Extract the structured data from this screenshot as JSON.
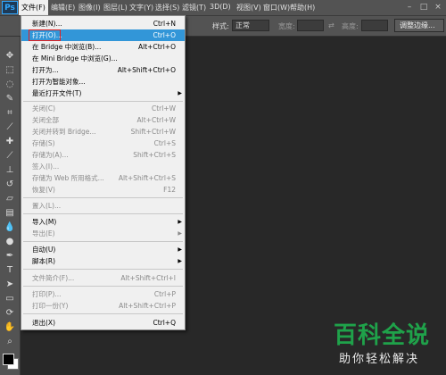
{
  "app": {
    "logo": "Ps"
  },
  "menubar": {
    "items": [
      "文件(F)",
      "编辑(E)",
      "图像(I)",
      "图层(L)",
      "文字(Y)",
      "选择(S)",
      "滤镜(T)",
      "3D(D)",
      "视图(V)",
      "窗口(W)",
      "帮助(H)"
    ]
  },
  "options": {
    "style_label": "样式:",
    "style_value": "正常",
    "width_label": "宽度:",
    "height_label": "高度:",
    "edge_button": "调整边缘..."
  },
  "file_menu": {
    "items": [
      {
        "label": "新建(N)...",
        "shortcut": "Ctrl+N",
        "disabled": false
      },
      {
        "label": "打开(O)...",
        "shortcut": "Ctrl+O",
        "disabled": false,
        "highlighted": true
      },
      {
        "label": "在 Bridge 中浏览(B)...",
        "shortcut": "Alt+Ctrl+O",
        "disabled": false
      },
      {
        "label": "在 Mini Bridge 中浏览(G)...",
        "shortcut": "",
        "disabled": false
      },
      {
        "label": "打开为...",
        "shortcut": "Alt+Shift+Ctrl+O",
        "disabled": false
      },
      {
        "label": "打开为智能对象...",
        "shortcut": "",
        "disabled": false
      },
      {
        "label": "最近打开文件(T)",
        "shortcut": "",
        "disabled": false,
        "submenu": true
      },
      {
        "label": "关闭(C)",
        "shortcut": "Ctrl+W",
        "disabled": true
      },
      {
        "label": "关闭全部",
        "shortcut": "Alt+Ctrl+W",
        "disabled": true
      },
      {
        "label": "关闭并转到 Bridge...",
        "shortcut": "Shift+Ctrl+W",
        "disabled": true
      },
      {
        "label": "存储(S)",
        "shortcut": "Ctrl+S",
        "disabled": true
      },
      {
        "label": "存储为(A)...",
        "shortcut": "Shift+Ctrl+S",
        "disabled": true
      },
      {
        "label": "签入(I)...",
        "shortcut": "",
        "disabled": true
      },
      {
        "label": "存储为 Web 所用格式...",
        "shortcut": "Alt+Shift+Ctrl+S",
        "disabled": true
      },
      {
        "label": "恢复(V)",
        "shortcut": "F12",
        "disabled": true
      },
      {
        "label": "置入(L)...",
        "shortcut": "",
        "disabled": true
      },
      {
        "label": "导入(M)",
        "shortcut": "",
        "disabled": false,
        "submenu": true
      },
      {
        "label": "导出(E)",
        "shortcut": "",
        "disabled": true,
        "submenu": true
      },
      {
        "label": "自动(U)",
        "shortcut": "",
        "disabled": false,
        "submenu": true
      },
      {
        "label": "脚本(R)",
        "shortcut": "",
        "disabled": false,
        "submenu": true
      },
      {
        "label": "文件简介(F)...",
        "shortcut": "Alt+Shift+Ctrl+I",
        "disabled": true
      },
      {
        "label": "打印(P)...",
        "shortcut": "Ctrl+P",
        "disabled": true
      },
      {
        "label": "打印一份(Y)",
        "shortcut": "Alt+Shift+Ctrl+P",
        "disabled": true
      },
      {
        "label": "退出(X)",
        "shortcut": "Ctrl+Q",
        "disabled": false
      }
    ]
  },
  "watermark": {
    "title": "百科全说",
    "subtitle": "助你轻松解决"
  },
  "colors": {
    "highlight": "#3296d8",
    "accent": "#31a8ff",
    "watermark_green": "#1fa24a"
  }
}
